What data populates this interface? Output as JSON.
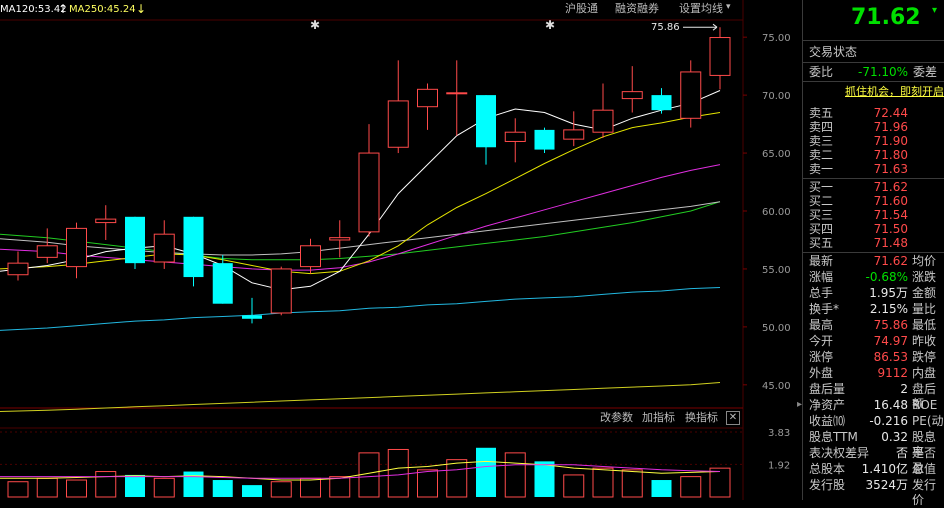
{
  "header": {
    "ma120_label": "MA120:53.42",
    "ma250_label": "MA250:45.24",
    "arrow_up_icon": "arrow-up",
    "arrow_down_icon": "arrow-down",
    "links": [
      "沪股通",
      "融资融券",
      "设置均线"
    ]
  },
  "price_axis": [
    "75.00",
    "70.00",
    "65.00",
    "60.00",
    "55.00",
    "50.00",
    "45.00"
  ],
  "indicator_bar": {
    "buttons": [
      "改参数",
      "加指标",
      "换指标"
    ],
    "close": "✕"
  },
  "indicator_axis": [
    "3.83",
    "1.92"
  ],
  "high_marker": "75.86",
  "colors": {
    "up": "#ff4a4a",
    "down": "#00ffff",
    "ma5": "#ffffff",
    "ma10": "#e5e500",
    "ma20": "#e02ee0",
    "ma30": "#c0c0c0",
    "ma60": "#22cc22",
    "ma120": "#22b8e0",
    "ma250": "#d0d020"
  },
  "chart_data": {
    "type": "candlestick",
    "ylim": [
      43.0,
      77.0
    ],
    "candles": [
      {
        "o": 54.5,
        "c": 55.5,
        "h": 56.5,
        "l": 54.0
      },
      {
        "o": 56.0,
        "c": 57.0,
        "h": 58.5,
        "l": 55.5
      },
      {
        "o": 55.2,
        "c": 58.5,
        "h": 59.0,
        "l": 54.2
      },
      {
        "o": 59.0,
        "c": 59.3,
        "h": 60.5,
        "l": 57.5
      },
      {
        "o": 59.5,
        "c": 55.5,
        "h": 59.5,
        "l": 55.0
      },
      {
        "o": 55.6,
        "c": 58.0,
        "h": 59.2,
        "l": 55.0
      },
      {
        "o": 59.5,
        "c": 54.3,
        "h": 59.5,
        "l": 53.5
      },
      {
        "o": 55.5,
        "c": 52.0,
        "h": 56.2,
        "l": 52.0
      },
      {
        "o": 51.0,
        "c": 50.7,
        "h": 52.5,
        "l": 50.3
      },
      {
        "o": 51.2,
        "c": 55.0,
        "h": 55.2,
        "l": 51.0
      },
      {
        "o": 55.2,
        "c": 57.0,
        "h": 57.6,
        "l": 54.6
      },
      {
        "o": 57.5,
        "c": 57.7,
        "h": 59.2,
        "l": 56.0
      },
      {
        "o": 58.2,
        "c": 65.0,
        "h": 67.5,
        "l": 57.8
      },
      {
        "o": 65.5,
        "c": 69.5,
        "h": 73.0,
        "l": 65.0
      },
      {
        "o": 69.0,
        "c": 70.5,
        "h": 71.0,
        "l": 67.0
      },
      {
        "o": 70.2,
        "c": 70.2,
        "h": 73.0,
        "l": 66.5
      },
      {
        "o": 70.0,
        "c": 65.5,
        "h": 70.0,
        "l": 64.0
      },
      {
        "o": 66.0,
        "c": 66.8,
        "h": 68.0,
        "l": 64.2
      },
      {
        "o": 67.0,
        "c": 65.3,
        "h": 67.2,
        "l": 65.0
      },
      {
        "o": 66.2,
        "c": 67.0,
        "h": 68.6,
        "l": 65.6
      },
      {
        "o": 66.8,
        "c": 68.7,
        "h": 71.0,
        "l": 66.3
      },
      {
        "o": 69.7,
        "c": 70.3,
        "h": 72.5,
        "l": 68.5
      },
      {
        "o": 70.0,
        "c": 68.7,
        "h": 70.6,
        "l": 68.4
      },
      {
        "o": 68.0,
        "c": 72.0,
        "h": 73.0,
        "l": 67.2
      },
      {
        "o": 71.7,
        "c": 74.97,
        "h": 75.86,
        "l": 70.5
      }
    ],
    "ma5": [
      54.8,
      55.3,
      55.8,
      56.5,
      56.8,
      57.0,
      56.3,
      55.3,
      53.8,
      53.2,
      53.5,
      54.8,
      58.0,
      61.5,
      64.0,
      66.5,
      68.0,
      68.8,
      68.5,
      67.5,
      67.0,
      68.0,
      68.7,
      69.3,
      70.4
    ],
    "ma10": [
      55.0,
      55.2,
      55.4,
      55.7,
      56.0,
      56.3,
      56.2,
      55.8,
      55.3,
      54.8,
      54.6,
      54.8,
      55.7,
      57.0,
      58.8,
      60.3,
      61.5,
      62.8,
      64.1,
      65.3,
      66.4,
      67.2,
      67.6,
      68.1,
      68.5
    ],
    "ma20": [
      56.7,
      56.5,
      56.2,
      56.0,
      55.8,
      55.6,
      55.4,
      55.2,
      55.0,
      54.9,
      54.9,
      55.1,
      55.6,
      56.3,
      57.1,
      57.9,
      58.7,
      59.4,
      60.1,
      60.8,
      61.5,
      62.2,
      62.9,
      63.5,
      64.0
    ],
    "ma30": [
      57.6,
      57.3,
      57.0,
      56.8,
      56.6,
      56.4,
      56.3,
      56.2,
      56.2,
      56.3,
      56.5,
      56.8,
      57.1,
      57.4,
      57.7,
      58.0,
      58.3,
      58.6,
      58.9,
      59.2,
      59.5,
      59.8,
      60.1,
      60.4,
      60.8
    ],
    "ma60": [
      58.0,
      57.7,
      57.4,
      57.1,
      56.8,
      56.5,
      56.2,
      55.9,
      55.8,
      55.8,
      55.8,
      55.9,
      56.1,
      56.3,
      56.6,
      56.9,
      57.2,
      57.5,
      57.8,
      58.2,
      58.6,
      59.0,
      59.5,
      60.0,
      60.8
    ],
    "ma120": [
      49.7,
      49.9,
      50.1,
      50.3,
      50.5,
      50.6,
      50.8,
      50.9,
      51.0,
      51.2,
      51.3,
      51.4,
      51.6,
      51.7,
      51.9,
      52.0,
      52.2,
      52.4,
      52.5,
      52.6,
      52.8,
      53.0,
      53.1,
      53.3,
      53.4
    ],
    "ma250": [
      42.7,
      42.8,
      42.9,
      43.0,
      43.1,
      43.2,
      43.3,
      43.4,
      43.5,
      43.6,
      43.7,
      43.8,
      43.9,
      44.0,
      44.1,
      44.2,
      44.3,
      44.4,
      44.5,
      44.6,
      44.7,
      44.8,
      44.9,
      45.0,
      45.2
    ],
    "indicator": {
      "ylim": [
        0,
        3.83
      ],
      "bars": [
        0.9,
        1.1,
        1.0,
        1.5,
        1.3,
        1.1,
        1.5,
        1.0,
        0.7,
        0.9,
        1.1,
        1.2,
        2.6,
        2.8,
        1.6,
        2.2,
        2.9,
        2.6,
        2.1,
        1.3,
        1.7,
        1.6,
        1.0,
        1.2,
        1.7
      ],
      "avg": [
        1.1,
        1.1,
        1.15,
        1.2,
        1.25,
        1.2,
        1.25,
        1.2,
        1.1,
        1.0,
        1.0,
        1.1,
        1.4,
        1.7,
        1.8,
        2.0,
        2.1,
        2.0,
        1.9,
        1.7,
        1.6,
        1.5,
        1.4,
        1.45,
        1.5
      ],
      "avg2": [
        1.2,
        1.2,
        1.2,
        1.2,
        1.2,
        1.2,
        1.2,
        1.15,
        1.1,
        1.1,
        1.1,
        1.1,
        1.2,
        1.3,
        1.5,
        1.6,
        1.8,
        1.9,
        1.9,
        1.9,
        1.8,
        1.7,
        1.6,
        1.55,
        1.5
      ]
    }
  },
  "panel": {
    "price": "71.62",
    "section_title": "交易状态",
    "weibi_label": "委比",
    "weibi_value": "-71.10%",
    "weicha_label": "委差",
    "ad_text": "抓住机会，即刻开启",
    "asks": [
      {
        "label": "卖五",
        "price": "72.44"
      },
      {
        "label": "卖四",
        "price": "71.96"
      },
      {
        "label": "卖三",
        "price": "71.90"
      },
      {
        "label": "卖二",
        "price": "71.80"
      },
      {
        "label": "卖一",
        "price": "71.63"
      }
    ],
    "bids": [
      {
        "label": "买一",
        "price": "71.62"
      },
      {
        "label": "买二",
        "price": "71.60"
      },
      {
        "label": "买三",
        "price": "71.54"
      },
      {
        "label": "买四",
        "price": "71.50"
      },
      {
        "label": "买五",
        "price": "71.48"
      }
    ],
    "stats": [
      {
        "label": "最新",
        "value": "71.62",
        "color": "red",
        "right": "均价"
      },
      {
        "label": "涨幅",
        "value": "-0.68%",
        "color": "green",
        "right": "涨跌"
      },
      {
        "label": "总手",
        "value": "1.95万",
        "color": "white",
        "right": "金额"
      },
      {
        "label": "换手*",
        "value": "2.15%",
        "color": "white",
        "right": "量比"
      },
      {
        "label": "最高",
        "value": "75.86",
        "color": "red",
        "right": "最低"
      },
      {
        "label": "今开",
        "value": "74.97",
        "color": "red",
        "right": "昨收"
      },
      {
        "label": "涨停",
        "value": "86.53",
        "color": "red",
        "right": "跌停"
      },
      {
        "label": "外盘",
        "value": "9112",
        "color": "red",
        "right": "内盘"
      },
      {
        "label": "盘后量",
        "value": "2",
        "color": "white",
        "right": "盘后额"
      },
      {
        "label": "净资产",
        "value": "16.48",
        "color": "white",
        "right": "ROE"
      },
      {
        "label": "收益⑽",
        "value": "-0.216",
        "color": "white",
        "right": "PE(动)"
      },
      {
        "label": "股息TTM",
        "value": "0.32",
        "color": "white",
        "right": "股息率"
      },
      {
        "label": "表决权差异",
        "value": "否",
        "color": "white",
        "right": "是否盈"
      },
      {
        "label": "总股本",
        "value": "1.410亿",
        "color": "white",
        "right": "总值"
      },
      {
        "label": "发行股",
        "value": "3524万",
        "color": "white",
        "right": "发行价"
      }
    ]
  }
}
